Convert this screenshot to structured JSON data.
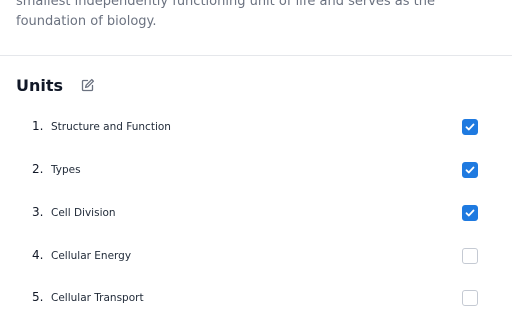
{
  "description": "smallest independently functioning unit of life and serves as the foundation of biology.",
  "units": {
    "title": "Units",
    "edit_icon": "edit-icon",
    "items": [
      {
        "number": "1.",
        "label": "Structure and Function",
        "checked": true
      },
      {
        "number": "2.",
        "label": "Types",
        "checked": true
      },
      {
        "number": "3.",
        "label": "Cell Division",
        "checked": true
      },
      {
        "number": "4.",
        "label": "Cellular Energy",
        "checked": false
      },
      {
        "number": "5.",
        "label": "Cellular Transport",
        "checked": false
      }
    ]
  },
  "colors": {
    "accent": "#1f7ae0",
    "checkbox_border": "#c5cad3",
    "description_text": "#6b7280"
  }
}
